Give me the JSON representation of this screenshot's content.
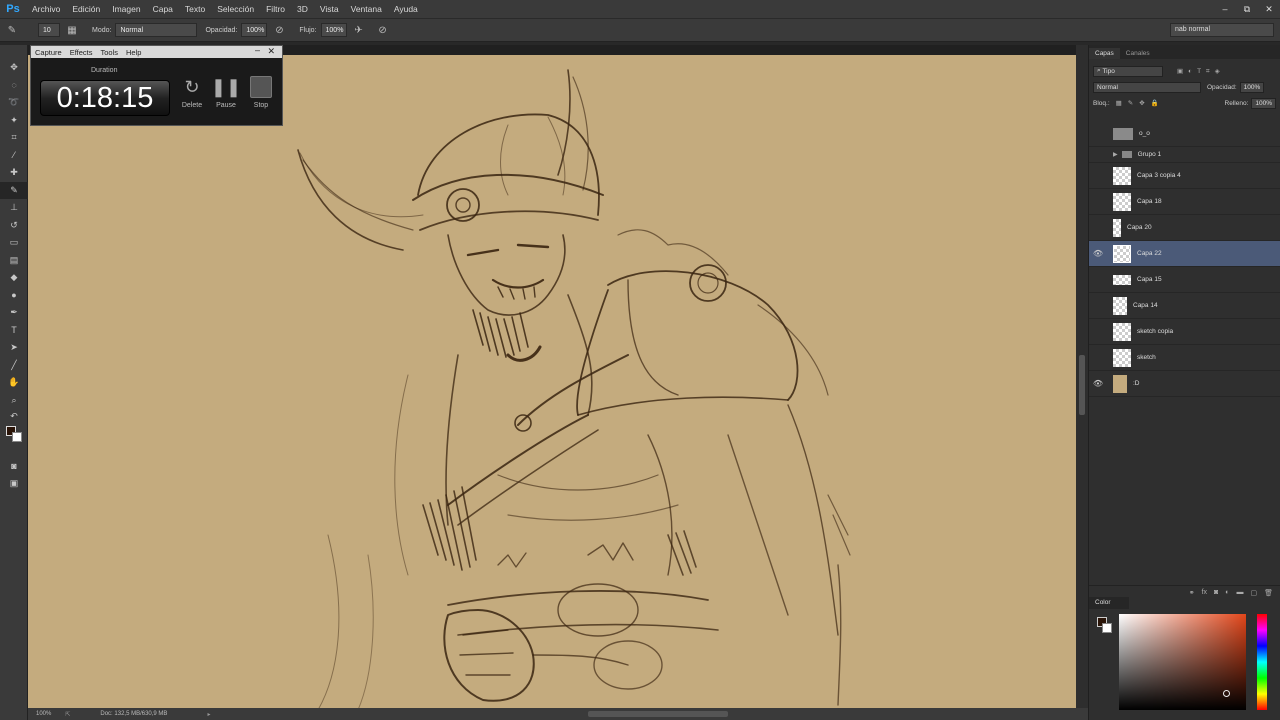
{
  "app": {
    "logo": "Ps"
  },
  "menu": [
    "Archivo",
    "Edición",
    "Imagen",
    "Capa",
    "Texto",
    "Selección",
    "Filtro",
    "3D",
    "Vista",
    "Ventana",
    "Ayuda"
  ],
  "window_controls": {
    "minimize": "–",
    "restore": "⧉",
    "close": "✕"
  },
  "options": {
    "brush_size": "10",
    "mode_label": "Modo:",
    "mode_value": "Normal",
    "opacity_label": "Opacidad:",
    "opacity_value": "100%",
    "flow_label": "Flujo:",
    "flow_value": "100%",
    "preset": "nab normal"
  },
  "timer": {
    "menu": [
      "Capture",
      "Effects",
      "Tools",
      "Help"
    ],
    "duration_label": "Duration",
    "time": "0:18:15",
    "buttons": {
      "delete": "Delete",
      "pause": "Pause",
      "stop": "Stop"
    }
  },
  "layers_panel": {
    "tabs": [
      "Capas",
      "Canales"
    ],
    "filter_kind": "Tipo",
    "blend_mode": "Normal",
    "opacity_label": "Opacidad:",
    "opacity_value": "100%",
    "lock_label": "Bloq.:",
    "fill_label": "Relleno:",
    "fill_value": "100%",
    "layers": [
      {
        "name": "o_o",
        "visible": false,
        "type": "gray"
      },
      {
        "name": "Grupo 1",
        "visible": false,
        "type": "group"
      },
      {
        "name": "Capa 3 copia 4",
        "visible": false,
        "type": "normal"
      },
      {
        "name": "Capa 18",
        "visible": false,
        "type": "normal"
      },
      {
        "name": "Capa 20",
        "visible": false,
        "type": "normal"
      },
      {
        "name": "Capa 22",
        "visible": true,
        "type": "normal",
        "selected": true
      },
      {
        "name": "Capa 15",
        "visible": false,
        "type": "normal"
      },
      {
        "name": "Capa 14",
        "visible": false,
        "type": "normal"
      },
      {
        "name": "sketch copia",
        "visible": false,
        "type": "normal"
      },
      {
        "name": "sketch",
        "visible": false,
        "type": "normal"
      },
      {
        "name": ":D",
        "visible": true,
        "type": "tan"
      }
    ]
  },
  "color_panel": {
    "title": "Color"
  },
  "status": {
    "zoom": "100%",
    "doc": "Doc: 132,5 MB/630,9 MB"
  },
  "colors": {
    "canvas": "#c4ab7e",
    "ink": "#3a2410",
    "selection": "#4b5a78"
  }
}
